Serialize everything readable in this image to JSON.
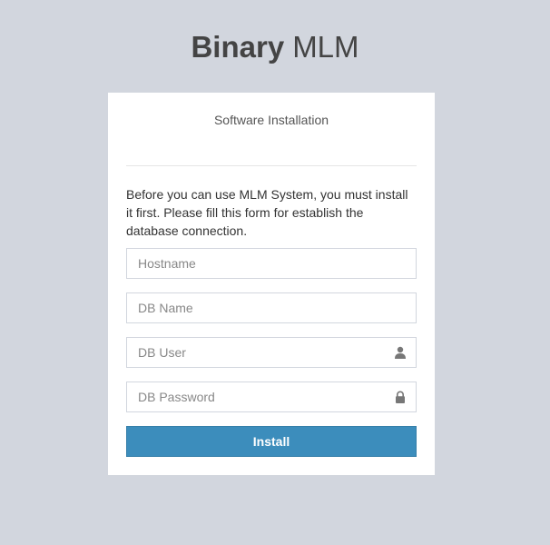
{
  "logo": {
    "bold": "Binary",
    "light": "MLM"
  },
  "card": {
    "title": "Software Installation",
    "message": "Before you can use MLM System, you must install it first. Please fill this form for establish the database connection."
  },
  "form": {
    "hostname_placeholder": "Hostname",
    "db_name_placeholder": "DB Name",
    "db_user_placeholder": "DB User",
    "db_password_placeholder": "DB Password",
    "install_label": "Install"
  },
  "icons": {
    "db_user": "user-icon",
    "db_password": "lock-icon"
  },
  "colors": {
    "background": "#d2d6de",
    "primary": "#3c8dbc"
  }
}
